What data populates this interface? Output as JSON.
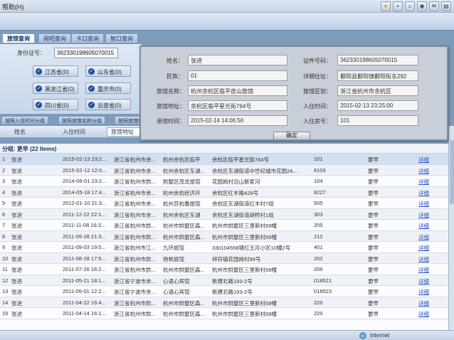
{
  "menubar": {
    "help_label": "帮助(H)"
  },
  "tabs": [
    "旅馆查询",
    "网吧查询",
    "卡口查询",
    "智口查询"
  ],
  "search": {
    "id_label": "身份证号：",
    "id_value": "362330198605070015"
  },
  "provinces": [
    "江苏省(0)",
    "山东省(0)",
    "黑龙江省(0)",
    "重庆市(0)",
    "四川省(0)",
    "云南省(0)"
  ],
  "subtabs": [
    "按照入住时间分组",
    "按照旅馆名称分组",
    "按照旅馆地址"
  ],
  "grid": {
    "headers": {
      "name": "姓名",
      "checkin": "入住时间",
      "hotel_addr": "旅馆地址"
    },
    "group_label": "分组: 更早 (22 Items)",
    "rows": [
      {
        "num": "1",
        "name": "张进",
        "time": "2015-02-13 23:2...",
        "addr": "浙江省杭州市余...",
        "hotel": "杭州余杭区临平",
        "haddr": "余杭区临平星光街764号",
        "room": "101",
        "status": "更早",
        "detail": "详细"
      },
      {
        "num": "2",
        "name": "张进",
        "time": "2015-02-12 12:0...",
        "addr": "浙江省杭州市余...",
        "hotel": "杭州余杭区东湖...",
        "haddr": "余杭区东湖街道中世纪城市花园24...",
        "room": "8103",
        "status": "更早",
        "detail": "详细"
      },
      {
        "num": "3",
        "name": "张进",
        "time": "2014-06-01 23:2...",
        "addr": "浙江省杭州市拱...",
        "hotel": "拱墅区茂龙旅馆",
        "haddr": "花园岗村沿山新家河",
        "room": "104",
        "status": "更早",
        "detail": "详细"
      },
      {
        "num": "4",
        "name": "张进",
        "time": "2014-05-18 17:4...",
        "addr": "浙江省杭州市余...",
        "hotel": "杭州余杭经济开",
        "haddr": "余杭区红丰路429号",
        "room": "8227",
        "status": "更早",
        "detail": "详细"
      },
      {
        "num": "5",
        "name": "张进",
        "time": "2012-01-10 21:3...",
        "addr": "浙江省杭州市余...",
        "hotel": "杭州苏杭春旅馆",
        "haddr": "余杭区东湖街道红丰村7组",
        "room": "505",
        "status": "更早",
        "detail": "详细"
      },
      {
        "num": "6",
        "name": "张进",
        "time": "2011-12-22 22:1...",
        "addr": "浙江省杭州市余...",
        "hotel": "杭州余杭区东湖",
        "haddr": "余杭区东湖街道胡桥村1组",
        "room": "303",
        "status": "更早",
        "detail": "详细"
      },
      {
        "num": "7",
        "name": "张进",
        "time": "2011-11-08 16:3...",
        "addr": "浙江省杭州市拱...",
        "hotel": "杭州市拱墅区森...",
        "haddr": "杭州市拱墅区三里新村69幢",
        "room": "205",
        "status": "更早",
        "detail": "详细"
      },
      {
        "num": "8",
        "name": "张进",
        "time": "2011-09-28 21:3...",
        "addr": "浙江省杭州市拱...",
        "hotel": "杭州市拱墅区森...",
        "haddr": "杭州市拱墅区三里新村69幢",
        "room": "212",
        "status": "更早",
        "detail": "详细"
      },
      {
        "num": "9",
        "name": "张进",
        "time": "2011-09-03 19:0...",
        "addr": "浙江省杭州市江...",
        "hotel": "九环旅馆",
        "haddr": "330104558塘红五月小区10幢2号",
        "room": "401",
        "status": "更早",
        "detail": "详细"
      },
      {
        "num": "10",
        "name": "张进",
        "time": "2011-08-28 17:5...",
        "addr": "浙江省杭州市拱...",
        "hotel": "扬帆旅馆",
        "haddr": "祥符镇花园岗村89号",
        "room": "202",
        "status": "更早",
        "detail": "详细"
      },
      {
        "num": "11",
        "name": "张进",
        "time": "2011-07-26 16:2...",
        "addr": "浙江省杭州市拱...",
        "hotel": "杭州市拱墅区森...",
        "haddr": "杭州市拱墅区三里新村69幢",
        "room": "206",
        "status": "更早",
        "detail": "详细"
      },
      {
        "num": "12",
        "name": "张进",
        "time": "2011-05-21 18:1...",
        "addr": "浙江省宁波市余...",
        "hotel": "心语心宾馆",
        "haddr": "新建北路193-2号",
        "room": "018521",
        "status": "更早",
        "detail": "详细"
      },
      {
        "num": "13",
        "name": "张进",
        "time": "2011-05-01 12:2...",
        "addr": "浙江省宁波市余...",
        "hotel": "心语心宾馆",
        "haddr": "新建北路193-2号",
        "room": "018523",
        "status": "更早",
        "detail": "详细"
      },
      {
        "num": "14",
        "name": "张进",
        "time": "2011-04-22 16:4...",
        "addr": "浙江省杭州市拱...",
        "hotel": "杭州市拱墅区森...",
        "haddr": "杭州市拱墅区三里新村69幢",
        "room": "220",
        "status": "更早",
        "detail": "详细"
      },
      {
        "num": "15",
        "name": "张进",
        "time": "2011-04-14 16:1...",
        "addr": "浙江省杭州市拱...",
        "hotel": "杭州市拱墅区森...",
        "haddr": "杭州市拱墅区三里新村69幢",
        "room": "220",
        "status": "更早",
        "detail": "详细"
      }
    ]
  },
  "modal": {
    "name_label": "姓名：",
    "name_value": "张进",
    "id_label": "证件号码：",
    "id_value": "362330198605070015",
    "ethnic_label": "民族：",
    "ethnic_value": "01",
    "detail_addr_label": "详细住址：",
    "detail_addr_value": "鄱阳县鄱阳镇鄱阳街东292",
    "hotel_name_label": "旅馆名称：",
    "hotel_name_value": "杭州余杭区临平皮山旅馆",
    "hotel_district_label": "旅馆区划：",
    "hotel_district_value": "浙江省杭州市余杭区",
    "hotel_addr_label": "旅馆地址：",
    "hotel_addr_value": "余杭区临平星光街764号",
    "checkin_label": "入住时间：",
    "checkin_value": "2015-02-13 23:25:00",
    "checkout_label": "退宿时间：",
    "checkout_value": "2015-02-14 14:06:56",
    "room_label": "入住房号：",
    "room_value": "101",
    "ok_label": "确定"
  },
  "statusbar": {
    "zone_label": "Internet"
  }
}
